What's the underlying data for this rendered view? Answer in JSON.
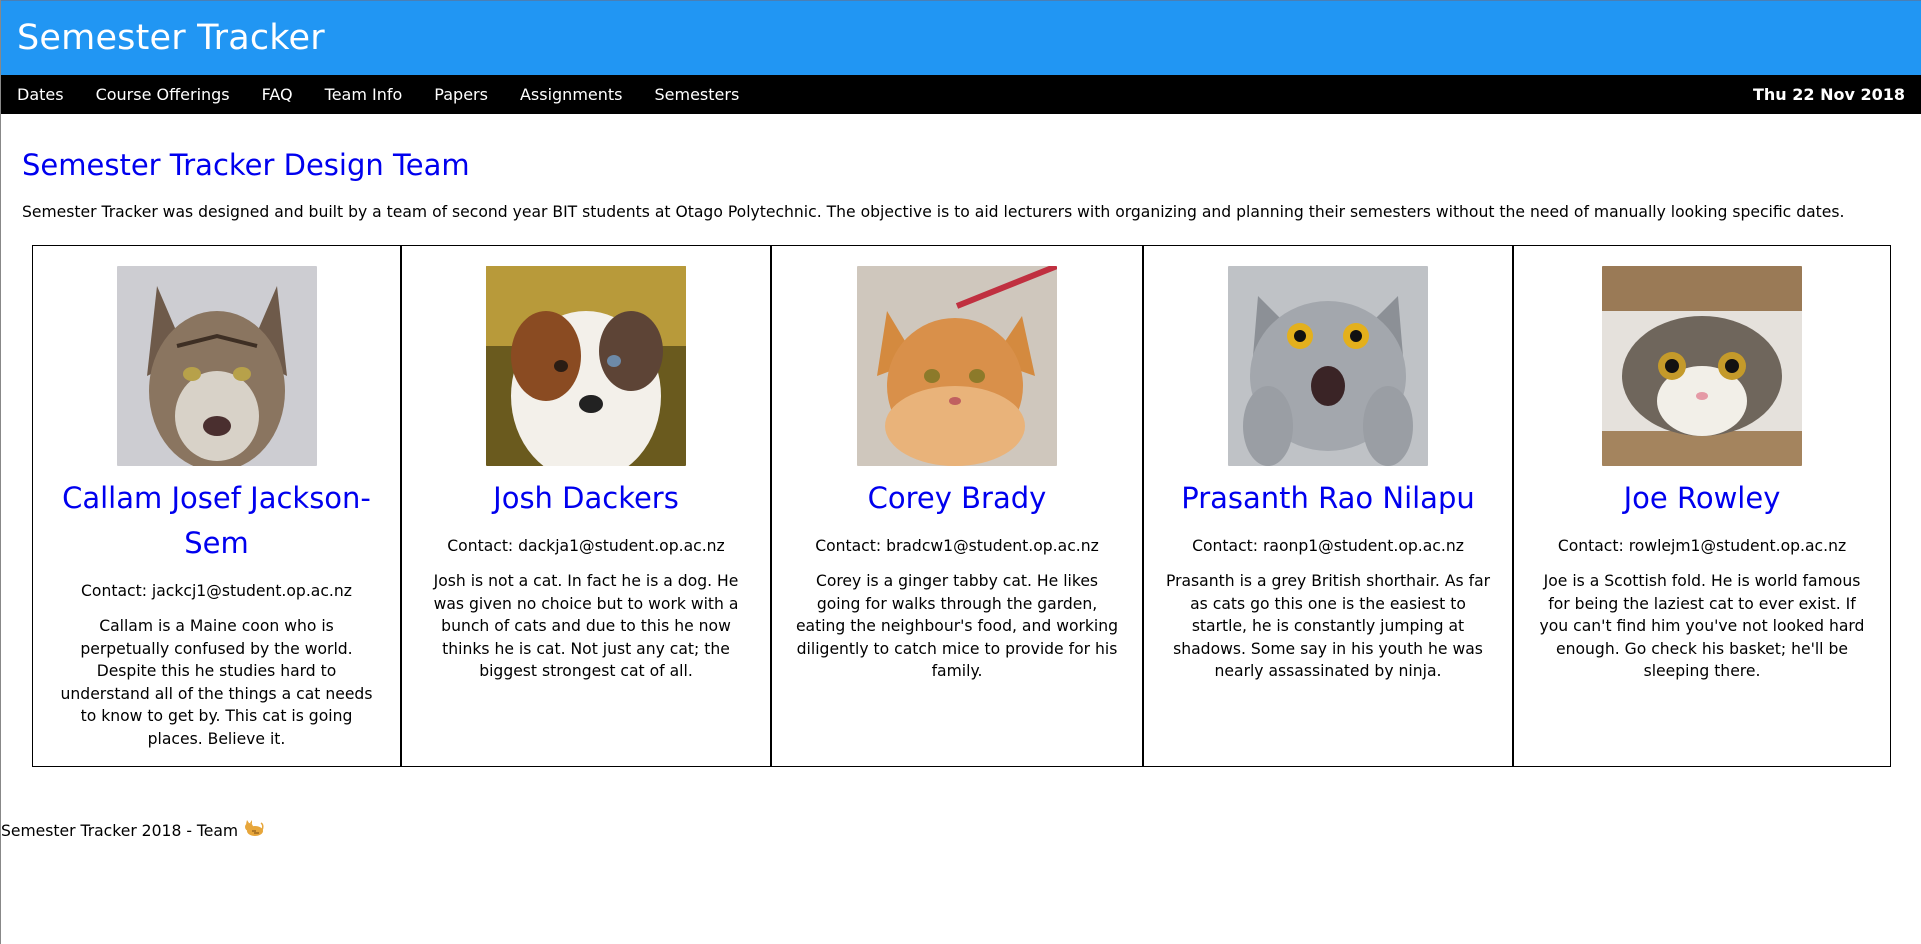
{
  "header": {
    "title": "Semester Tracker"
  },
  "nav": {
    "items": [
      "Dates",
      "Course Offerings",
      "FAQ",
      "Team Info",
      "Papers",
      "Assignments",
      "Semesters"
    ],
    "date": "Thu 22 Nov 2018"
  },
  "main": {
    "heading": "Semester Tracker Design Team",
    "intro": "Semester Tracker was designed and built by a team of second year BIT students at Otago Polytechnic. The objective is to aid lecturers with organizing and planning their semesters without the need of manually looking specific dates."
  },
  "team": [
    {
      "name": "Callam Josef Jackson-Sem",
      "contact": "Contact: jackcj1@student.op.ac.nz",
      "bio": "Callam is a Maine coon who is perpetually confused by the world. Despite this he studies hard to understand all of the things a cat needs to know to get by. This cat is going places. Believe it.",
      "photo": "maine-coon-cat-photo"
    },
    {
      "name": "Josh Dackers",
      "contact": "Contact: dackja1@student.op.ac.nz",
      "bio": "Josh is not a cat. In fact he is a dog. He was given no choice but to work with a bunch of cats and due to this he now thinks he is cat. Not just any cat; the biggest strongest cat of all.",
      "photo": "australian-shepherd-dog-photo"
    },
    {
      "name": "Corey Brady",
      "contact": "Contact: bradcw1@student.op.ac.nz",
      "bio": "Corey is a ginger tabby cat. He likes going for walks through the garden, eating the neighbour's food, and working diligently to catch mice to provide for his family.",
      "photo": "ginger-tabby-cat-photo"
    },
    {
      "name": "Prasanth Rao Nilapu",
      "contact": "Contact: raonp1@student.op.ac.nz",
      "bio": "Prasanth is a grey British shorthair. As far as cats go this one is the easiest to startle, he is constantly jumping at shadows. Some say in his youth he was nearly assassinated by ninja.",
      "photo": "grey-shorthair-cat-photo"
    },
    {
      "name": "Joe Rowley",
      "contact": "Contact: rowlejm1@student.op.ac.nz",
      "bio": "Joe is a Scottish fold. He is world famous for being the laziest cat to ever exist. If you can't find him you've not looked hard enough. Go check his basket; he'll be sleeping there.",
      "photo": "scottish-fold-cat-photo"
    }
  ],
  "footer": {
    "text": "Semester Tracker 2018 - Team",
    "icon": "cat-emoji-icon"
  }
}
